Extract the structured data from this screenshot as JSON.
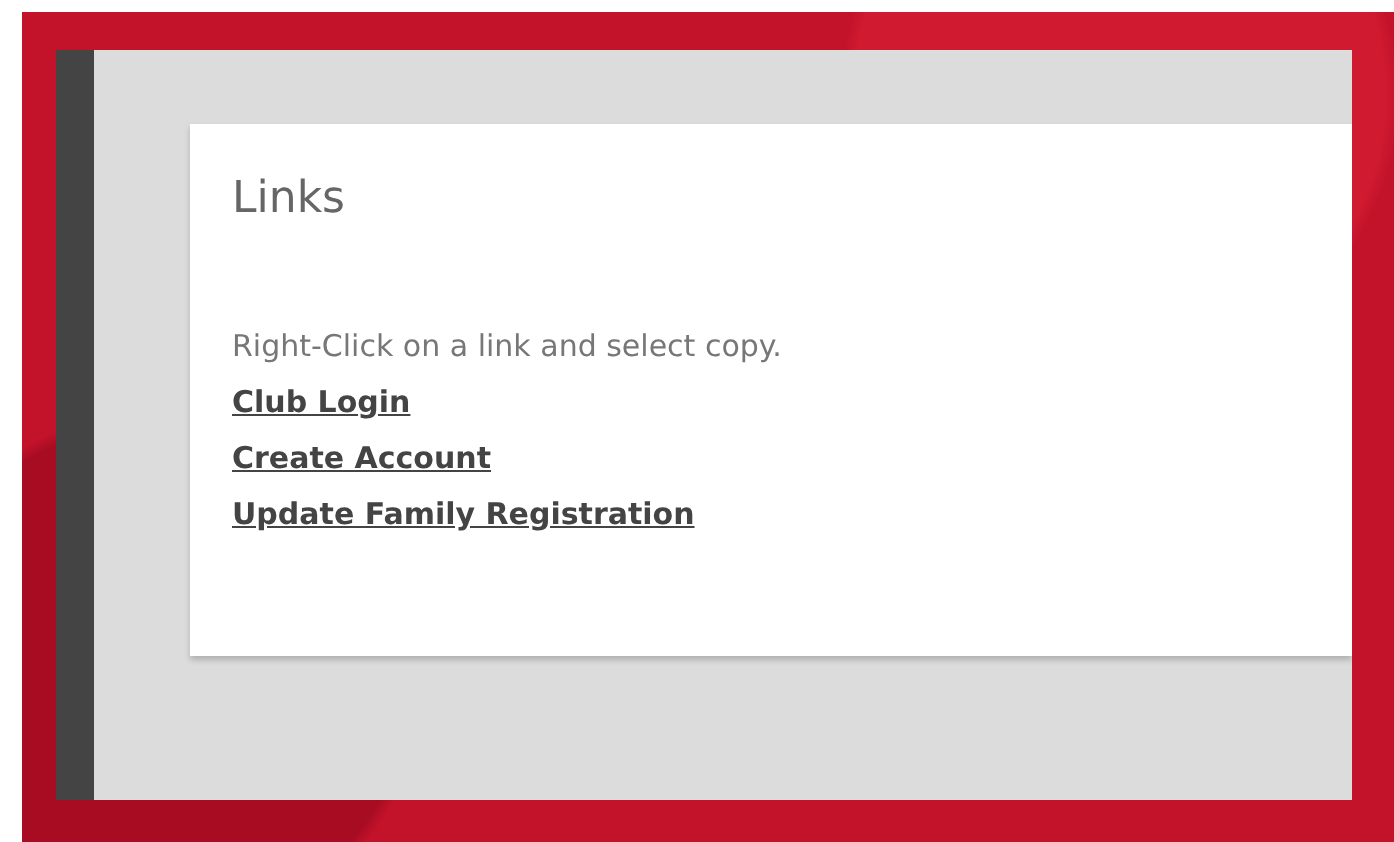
{
  "card": {
    "title": "Links",
    "instruction": "Right-Click on a link and select copy.",
    "links": [
      {
        "label": "Club Login"
      },
      {
        "label": "Create Account"
      },
      {
        "label": "Update Family Registration"
      }
    ]
  }
}
